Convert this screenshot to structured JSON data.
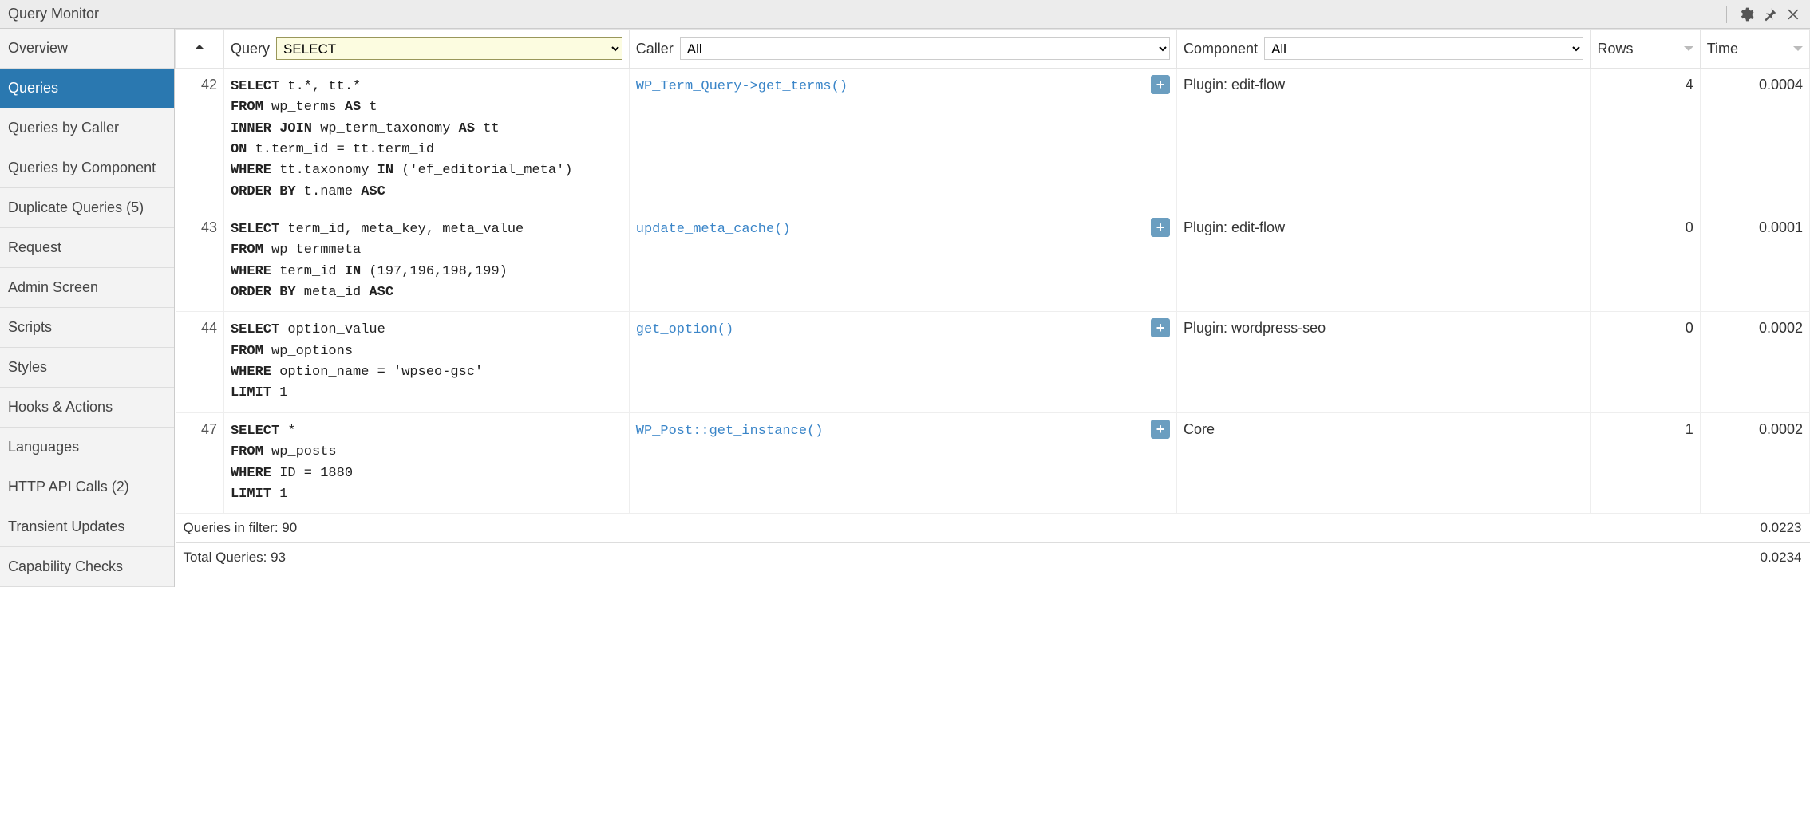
{
  "title": "Query Monitor",
  "sidebar": {
    "items": [
      {
        "label": "Overview",
        "active": false
      },
      {
        "label": "Queries",
        "active": true
      },
      {
        "label": "Queries by Caller",
        "active": false
      },
      {
        "label": "Queries by Component",
        "active": false
      },
      {
        "label": "Duplicate Queries (5)",
        "active": false
      },
      {
        "label": "Request",
        "active": false
      },
      {
        "label": "Admin Screen",
        "active": false
      },
      {
        "label": "Scripts",
        "active": false
      },
      {
        "label": "Styles",
        "active": false
      },
      {
        "label": "Hooks & Actions",
        "active": false
      },
      {
        "label": "Languages",
        "active": false
      },
      {
        "label": "HTTP API Calls (2)",
        "active": false
      },
      {
        "label": "Transient Updates",
        "active": false
      },
      {
        "label": "Capability Checks",
        "active": false
      }
    ]
  },
  "columns": {
    "num": "",
    "query": {
      "label": "Query",
      "filter": "SELECT"
    },
    "caller": {
      "label": "Caller",
      "filter": "All"
    },
    "component": {
      "label": "Component",
      "filter": "All"
    },
    "rows": "Rows",
    "time": "Time"
  },
  "rows": [
    {
      "num": "42",
      "sql": [
        {
          "kw": "SELECT",
          "rest": " t.*, tt.*"
        },
        {
          "kw": "FROM",
          "rest": " wp_terms "
        },
        {
          "kw": "AS",
          "rest": " t"
        },
        {
          "kw": "INNER JOIN",
          "rest": " wp_term_taxonomy "
        },
        {
          "kw": "AS",
          "rest": " tt"
        },
        {
          "kw": "ON",
          "rest": " t.term_id = tt.term_id"
        },
        {
          "kw": "WHERE",
          "rest": " tt.taxonomy "
        },
        {
          "kw": "IN",
          "rest": " ('ef_editorial_meta')"
        },
        {
          "kw": "ORDER BY",
          "rest": " t.name "
        },
        {
          "kw": "ASC",
          "rest": ""
        }
      ],
      "caller": "WP_Term_Query->get_terms()",
      "component": "Plugin: edit-flow",
      "rows": "4",
      "time": "0.0004"
    },
    {
      "num": "43",
      "sql": [
        {
          "kw": "SELECT",
          "rest": " term_id, meta_key, meta_value"
        },
        {
          "kw": "FROM",
          "rest": " wp_termmeta"
        },
        {
          "kw": "WHERE",
          "rest": " term_id "
        },
        {
          "kw": "IN",
          "rest": " (197,196,198,199)"
        },
        {
          "kw": "ORDER BY",
          "rest": " meta_id "
        },
        {
          "kw": "ASC",
          "rest": ""
        }
      ],
      "caller": "update_meta_cache()",
      "component": "Plugin: edit-flow",
      "rows": "0",
      "time": "0.0001"
    },
    {
      "num": "44",
      "sql": [
        {
          "kw": "SELECT",
          "rest": " option_value"
        },
        {
          "kw": "FROM",
          "rest": " wp_options"
        },
        {
          "kw": "WHERE",
          "rest": " option_name = 'wpseo-gsc'"
        },
        {
          "kw": "LIMIT",
          "rest": " 1"
        }
      ],
      "caller": "get_option()",
      "component": "Plugin: wordpress-seo",
      "rows": "0",
      "time": "0.0002"
    },
    {
      "num": "47",
      "sql": [
        {
          "kw": "SELECT",
          "rest": " *"
        },
        {
          "kw": "FROM",
          "rest": " wp_posts"
        },
        {
          "kw": "WHERE",
          "rest": " ID = 1880"
        },
        {
          "kw": "LIMIT",
          "rest": " 1"
        }
      ],
      "caller": "WP_Post::get_instance()",
      "component": "Core",
      "rows": "1",
      "time": "0.0002"
    }
  ],
  "footer": {
    "filter_label": "Queries in filter: 90",
    "filter_time": "0.0223",
    "total_label": "Total Queries: 93",
    "total_time": "0.0234"
  }
}
